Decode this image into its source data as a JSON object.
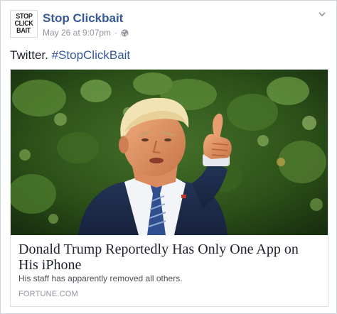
{
  "post": {
    "page_name": "Stop Clickbait",
    "avatar_logo_lines": [
      "STOP",
      "CLICK",
      "BAIT"
    ],
    "timestamp": "May 26 at 9:07pm",
    "separator": "·",
    "privacy_icon": "globe-icon",
    "menu_icon": "chevron-down-icon",
    "text_prefix": "Twitter.",
    "hashtag": "#StopClickBait"
  },
  "link_card": {
    "image_subject": "man-in-suit-thumbs-up-photo",
    "title": "Donald Trump Reportedly Has Only One App on His iPhone",
    "description": "His staff has apparently removed all others.",
    "source": "FORTUNE.COM"
  },
  "colors": {
    "link_blue": "#365899",
    "text_dark": "#1d2129",
    "meta_gray": "#90949c",
    "border": "#dddfe2"
  }
}
